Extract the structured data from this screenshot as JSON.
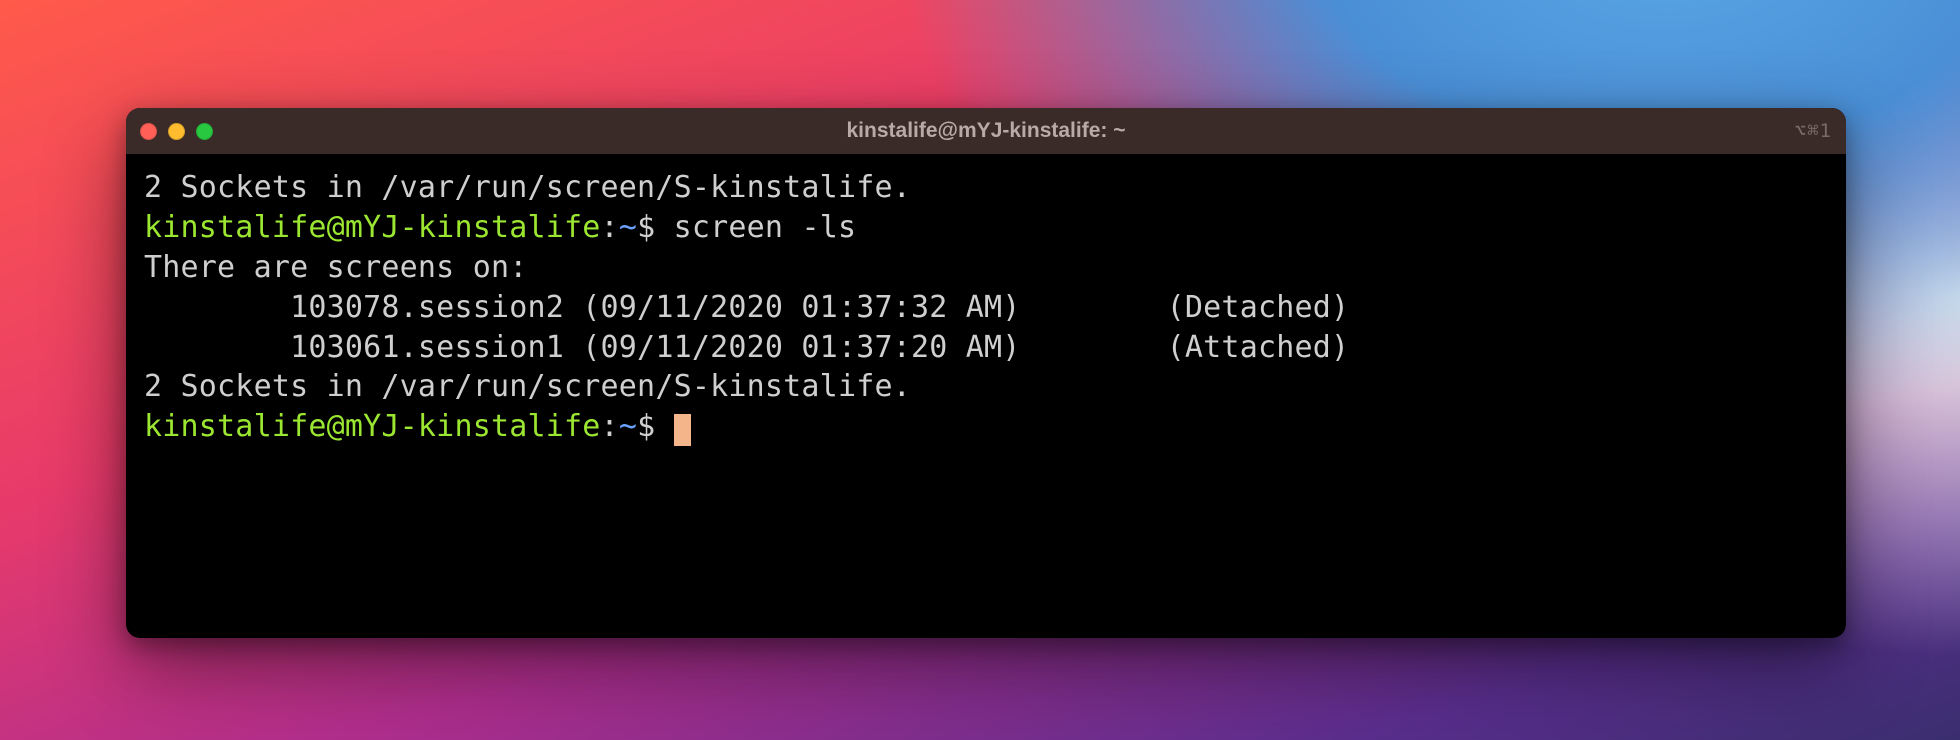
{
  "window": {
    "title": "kinstalife@mYJ-kinstalife: ~",
    "right_indicator": "⌥⌘1"
  },
  "terminal": {
    "line1_sockets": "2 Sockets in /var/run/screen/S-kinstalife.",
    "prompt1": {
      "userhost": "kinstalife@mYJ-kinstalife",
      "sep": ":",
      "path": "~",
      "dollar": "$",
      "command": "screen -ls"
    },
    "header": "There are screens on:",
    "session_line1": "        103078.session2 (09/11/2020 01:37:32 AM)        (Detached)",
    "session_line2": "        103061.session1 (09/11/2020 01:37:20 AM)        (Attached)",
    "line_sockets2": "2 Sockets in /var/run/screen/S-kinstalife.",
    "prompt2": {
      "userhost": "kinstalife@mYJ-kinstalife",
      "sep": ":",
      "path": "~",
      "dollar": "$"
    }
  }
}
